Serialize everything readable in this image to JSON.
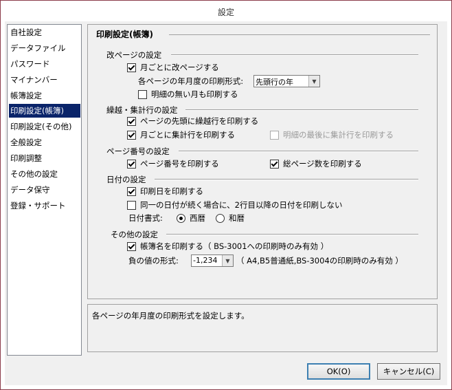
{
  "window": {
    "title": "設定"
  },
  "sidebar": {
    "items": [
      {
        "label": "自社設定"
      },
      {
        "label": "データファイル"
      },
      {
        "label": "パスワード"
      },
      {
        "label": "マイナンバー"
      },
      {
        "label": "帳簿設定"
      },
      {
        "label": "印刷設定(帳簿)",
        "selected": true
      },
      {
        "label": "印刷設定(その他)"
      },
      {
        "label": "全般設定"
      },
      {
        "label": "印刷調整"
      },
      {
        "label": "その他の設定"
      },
      {
        "label": "データ保守"
      },
      {
        "label": "登録・サポート"
      }
    ]
  },
  "panel": {
    "title": "印刷設定(帳簿)",
    "page_break": {
      "label": "改ページの設定",
      "monthly_break": {
        "label": "月ごとに改ページする",
        "checked": true
      },
      "format_label": "各ページの年月度の印刷形式:",
      "format_value": "先頭行の年",
      "print_empty_months": {
        "label": "明細の無い月も印刷する",
        "checked": false
      }
    },
    "carry": {
      "label": "繰越・集計行の設定",
      "print_carry_top": {
        "label": "ページの先頭に繰越行を印刷する",
        "checked": true
      },
      "print_monthly_total": {
        "label": "月ごとに集計行を印刷する",
        "checked": true
      },
      "print_total_last": {
        "label": "明細の最後に集計行を印刷する",
        "checked": false,
        "disabled": true
      }
    },
    "page_number": {
      "label": "ページ番号の設定",
      "print_page_no": {
        "label": "ページ番号を印刷する",
        "checked": true
      },
      "print_total_pages": {
        "label": "総ページ数を印刷する",
        "checked": true
      }
    },
    "date": {
      "label": "日付の設定",
      "print_date": {
        "label": "印刷日を印刷する",
        "checked": true
      },
      "skip_same_date": {
        "label": "同一の日付が続く場合に、2行目以降の日付を印刷しない",
        "checked": false
      },
      "format_label": "日付書式:",
      "western": {
        "label": "西暦",
        "selected": true
      },
      "japanese": {
        "label": "和暦",
        "selected": false
      }
    },
    "other": {
      "label": "その他の設定",
      "print_book_name": {
        "label": "帳簿名を印刷する（ BS-3001への印刷時のみ有効 ）",
        "checked": true
      },
      "negative_label": "負の値の形式:",
      "negative_value": "-1,234",
      "negative_note": "（ A4,B5普通紙,BS-3004の印刷時のみ有効 ）"
    }
  },
  "help": {
    "text": "各ページの年月度の印刷形式を設定します。"
  },
  "buttons": {
    "ok": "OK(O)",
    "cancel": "キャンセル(C)"
  }
}
